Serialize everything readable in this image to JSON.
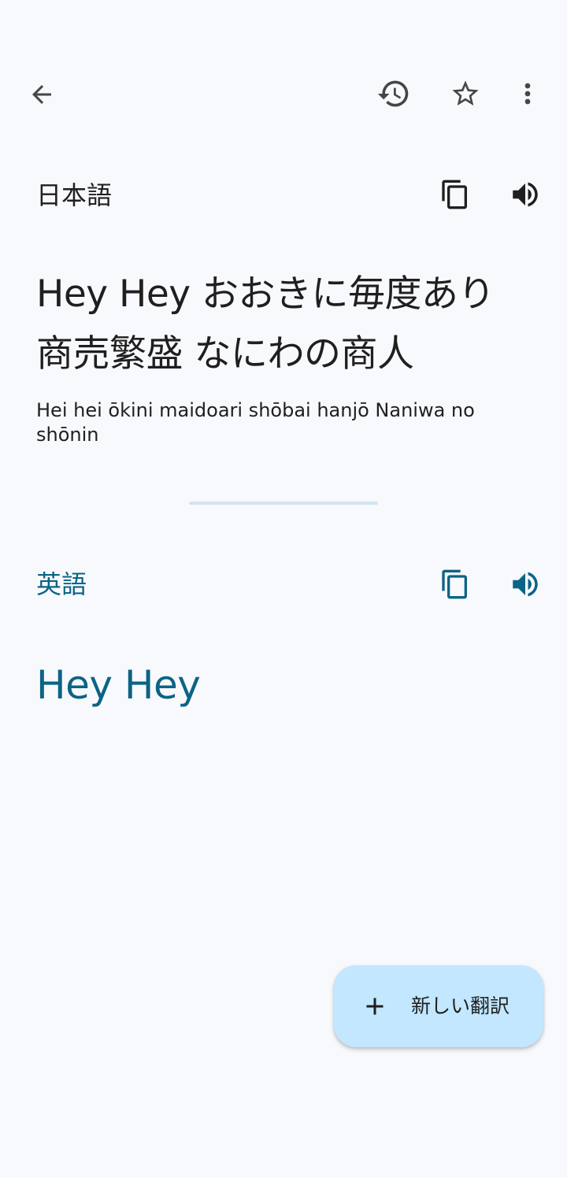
{
  "toolbar": {
    "back_icon": "arrow-back-icon",
    "history_icon": "history-icon",
    "favorite_icon": "star-outline-icon",
    "more_icon": "more-vert-icon"
  },
  "source": {
    "language_label": "日本語",
    "text": "Hey Hey おおきに毎度あり 商売繁盛 なにわの商人",
    "transliteration": "Hei hei ōkini maidoari shōbai hanjō Naniwa no shōnin",
    "copy_icon": "copy-icon",
    "speak_icon": "volume-up-icon"
  },
  "target": {
    "language_label": "英語",
    "text": "Hey Hey",
    "copy_icon": "copy-icon",
    "speak_icon": "volume-up-icon"
  },
  "fab": {
    "label": "新しい翻訳",
    "icon": "plus-icon"
  },
  "colors": {
    "background": "#F8F9FD",
    "accent": "#0B6484",
    "fab_background": "#C2E7FF",
    "divider": "#D3E4F0",
    "text_primary": "#1F1F1F"
  }
}
